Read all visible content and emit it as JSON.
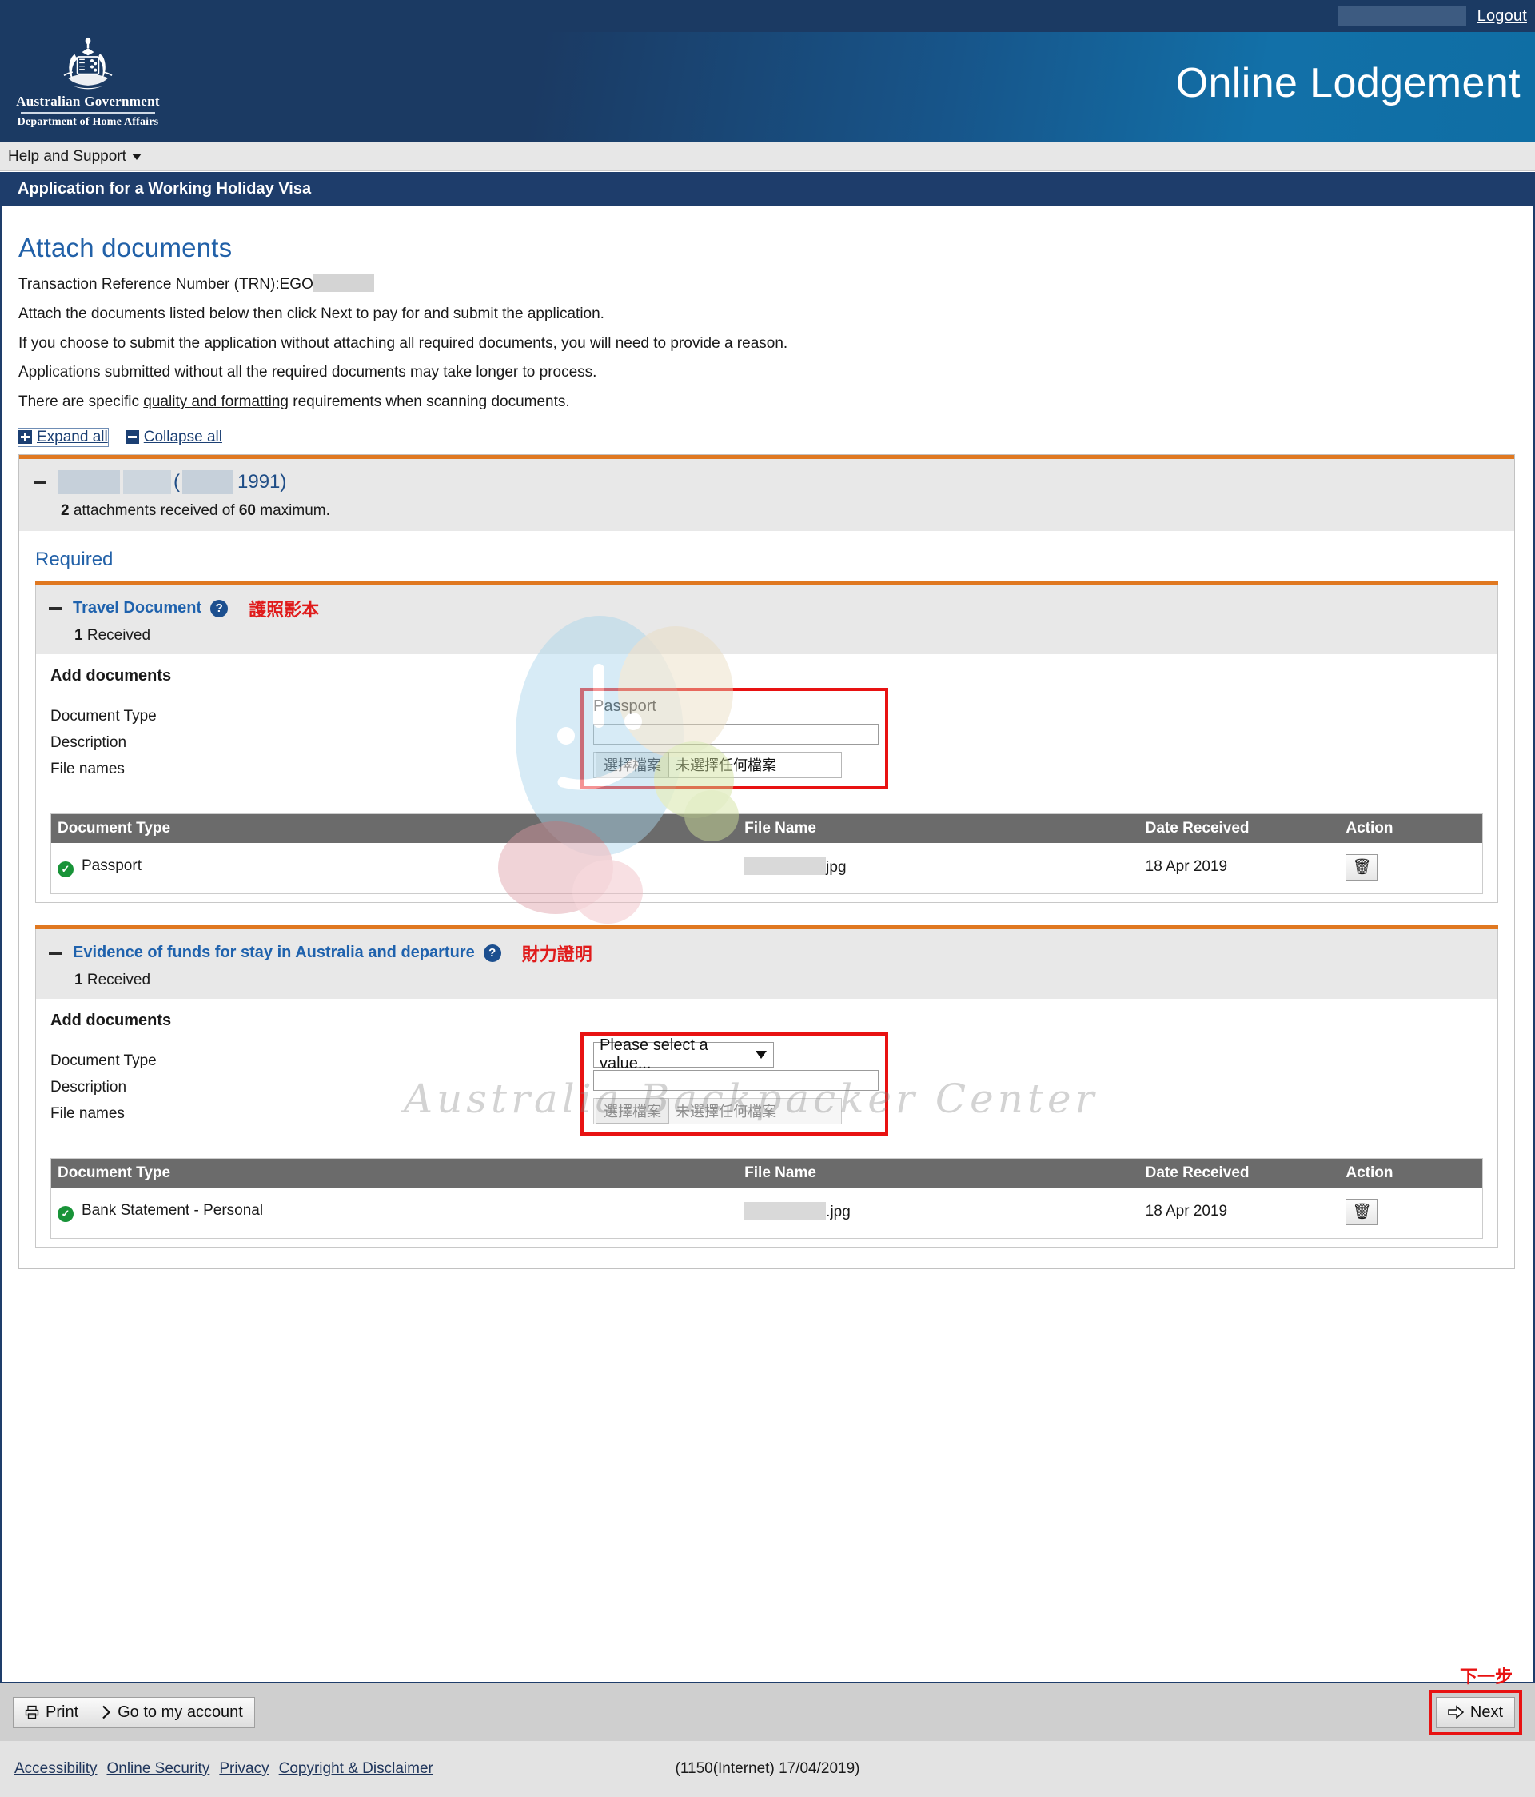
{
  "topbar": {
    "logout_label": "Logout"
  },
  "masthead": {
    "crest_line1": "Australian Government",
    "crest_line2": "Department of Home Affairs",
    "app_title": "Online Lodgement"
  },
  "helpbar": {
    "label": "Help and Support"
  },
  "page_banner": {
    "title": "Application for a Working Holiday Visa"
  },
  "page": {
    "heading": "Attach documents",
    "trn_prefix": "Transaction Reference Number (TRN):EGO",
    "paragraph_1": "Attach the documents listed below then click Next to pay for and submit the application.",
    "paragraph_2": "If you choose to submit the application without attaching all required documents, you will need to provide a reason.",
    "paragraph_3": "Applications submitted without all the required documents may take longer to process.",
    "paragraph_4_pre": "There are specific ",
    "paragraph_4_link": "quality and formatting",
    "paragraph_4_post": " requirements when scanning documents.",
    "expand_all": "Expand all",
    "collapse_all": "Collapse all"
  },
  "applicant": {
    "year": "1991)",
    "open_paren": "(",
    "attachments_count": "2",
    "attachments_text_mid": " attachments received of ",
    "attachments_max": "60",
    "attachments_text_end": " maximum."
  },
  "required_section": {
    "heading": "Required"
  },
  "sections": [
    {
      "title": "Travel Document",
      "help_icon": "question-mark-icon",
      "annotation": "護照影本",
      "received_count": "1",
      "received_label": " Received",
      "add_documents_label": "Add documents",
      "labels": {
        "document_type": "Document Type",
        "description": "Description",
        "file_names": "File names"
      },
      "document_type_value": "Passport",
      "document_type_is_select": false,
      "description_value": "",
      "file_button_label": "選擇檔案",
      "file_status_text": "未選擇任何檔案",
      "file_input_disabled": false,
      "table": {
        "headers": [
          "Document Type",
          "File Name",
          "Date Received",
          "Action"
        ],
        "rows": [
          {
            "status_icon": "green-check-icon",
            "document_type": "Passport",
            "file_name_suffix": "jpg",
            "date_received": "18 Apr 2019",
            "action_icon": "trash-icon"
          }
        ]
      }
    },
    {
      "title": "Evidence of funds for stay in Australia and departure",
      "help_icon": "question-mark-icon",
      "annotation": "財力證明",
      "received_count": "1",
      "received_label": " Received",
      "add_documents_label": "Add documents",
      "labels": {
        "document_type": "Document Type",
        "description": "Description",
        "file_names": "File names"
      },
      "document_type_value": "Please select a value...",
      "document_type_is_select": true,
      "description_value": "",
      "file_button_label": "選擇檔案",
      "file_status_text": "未選擇任何檔案",
      "file_input_disabled": true,
      "table": {
        "headers": [
          "Document Type",
          "File Name",
          "Date Received",
          "Action"
        ],
        "rows": [
          {
            "status_icon": "green-check-icon",
            "document_type": "Bank Statement - Personal",
            "file_name_suffix": ".jpg",
            "date_received": "18 Apr 2019",
            "action_icon": "trash-icon"
          }
        ]
      }
    }
  ],
  "footer": {
    "print_label": "Print",
    "account_label": "Go to my account",
    "next_label": "Next",
    "next_annotation": "下一步",
    "links": [
      "Accessibility",
      "Online Security",
      "Privacy",
      "Copyright & Disclaimer"
    ],
    "version": "(1150(Internet) 17/04/2019)"
  },
  "watermark": {
    "text": "Australia Backpacker Center"
  },
  "colors": {
    "navy": "#1e3d6b",
    "orange_rule": "#e07820",
    "link_blue": "#2261a8",
    "annotation_red": "#e01b1b",
    "highlight_red": "#e81212",
    "success_green": "#189338",
    "table_header_grey": "#6b6b6b"
  }
}
